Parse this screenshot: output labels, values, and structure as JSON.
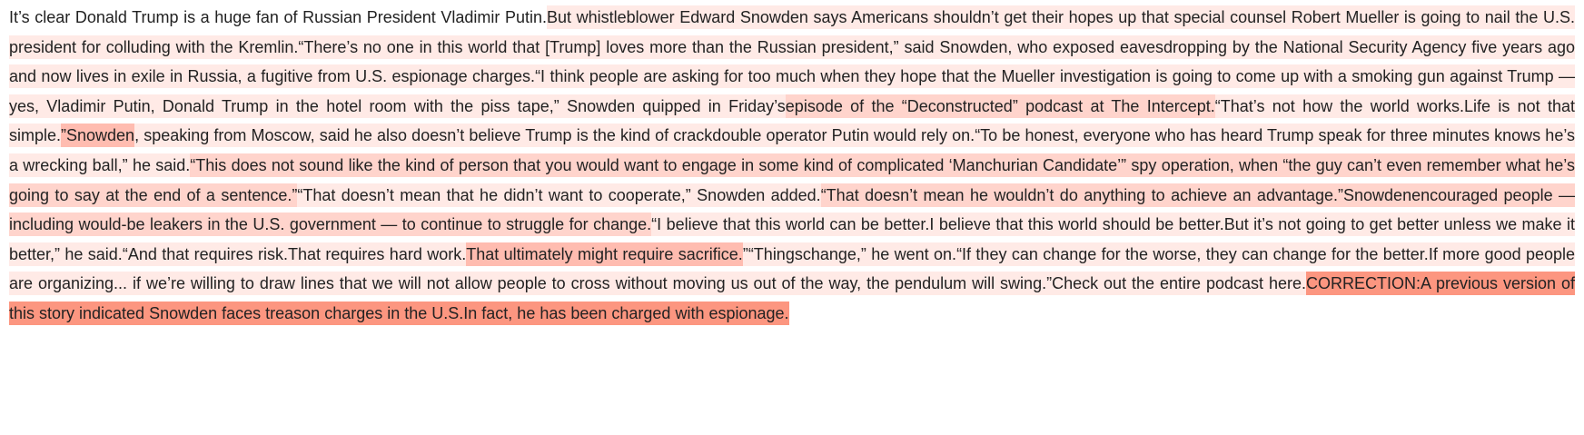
{
  "colors": {
    "l1": "#ffeae6",
    "l2": "#ffd4cc",
    "l3": "#ffbcb0",
    "l4": "#fc9680"
  },
  "segments": [
    {
      "text": "It’s clear Donald Trump is a huge fan of Russian President Vladimir Putin.",
      "level": 0
    },
    {
      "text": "But whistleblower Edward Snowden says Americans shouldn’t get their hopes up that special counsel Robert Mueller is going to nail the U.S. president for colluding with the Kremlin.",
      "level": 1
    },
    {
      "text": "“There’s no one in this world that [Trump] loves more than the Russian president,” said Snowden, who exposed eavesdropping by the National Security Agency five years ago and now lives in exile in Russia, a fugitive from U.S. espionage charges.",
      "level": 1
    },
    {
      "text": "“I think people are asking for too much when they hope that the Mueller investigation is going to come up with a smoking gun against Trump —yes, Vladimir Putin, Donald Trump in the hotel room with the piss tape,” Snowden quipped in Friday’s",
      "level": 1
    },
    {
      "text": "episode of the “Deconstructed” podcast at The Intercept.",
      "level": 2
    },
    {
      "text": "“That’s not how the world works.",
      "level": 1
    },
    {
      "text": "Life is not that simple.",
      "level": 1
    },
    {
      "text": "”Snowden",
      "level": 3
    },
    {
      "text": ", speaking from Moscow, said he also doesn’t believe Trump is the kind of crackdouble operator Putin would rely on.",
      "level": 1
    },
    {
      "text": "“To be honest, everyone who has heard Trump speak for three minutes knows he’s a wrecking ball,” he said.",
      "level": 1
    },
    {
      "text": "“This does not sound like the kind of person that you would want to engage in some kind of complicated ‘Manchurian Candidate’” spy operation, when “the guy can’t even remember what he’s going to say at the end of a sentence.”",
      "level": 2
    },
    {
      "text": "“That doesn’t mean that he didn’t want to cooperate,” Snowden added.",
      "level": 1
    },
    {
      "text": "“That doesn’t mean he wouldn’t do anything to achieve an advantage.”",
      "level": 2
    },
    {
      "text": "Snowdenencouraged people — including would-be leakers in the U.S. government — to continue to struggle for change.",
      "level": 2
    },
    {
      "text": "“I believe that this world can be better.",
      "level": 1
    },
    {
      "text": "I believe that this world should be better.",
      "level": 1
    },
    {
      "text": "But it’s not going to get better unless we make it better,” he said.",
      "level": 1
    },
    {
      "text": "“And that requires risk.",
      "level": 1
    },
    {
      "text": "That requires hard work.",
      "level": 1
    },
    {
      "text": "That ultimately might require sacrifice.",
      "level": 3
    },
    {
      "text": "”",
      "level": 1
    },
    {
      "text": "“Thingschange,” he went on.",
      "level": 1
    },
    {
      "text": "“If they can change for the worse, they can change for the better.",
      "level": 1
    },
    {
      "text": "If more good people are organizing... if we’re willing to draw lines that we will not allow people to cross without moving us out of the way, the pendulum will swing.",
      "level": 1
    },
    {
      "text": "”Check out the entire podcast here.",
      "level": 1
    },
    {
      "text": "CORRECTION:A previous version of this story indicated Snowden faces treason charges in the U.S.",
      "level": 4
    },
    {
      "text": "In fact, he has been charged with espionage.",
      "level": 4
    }
  ]
}
